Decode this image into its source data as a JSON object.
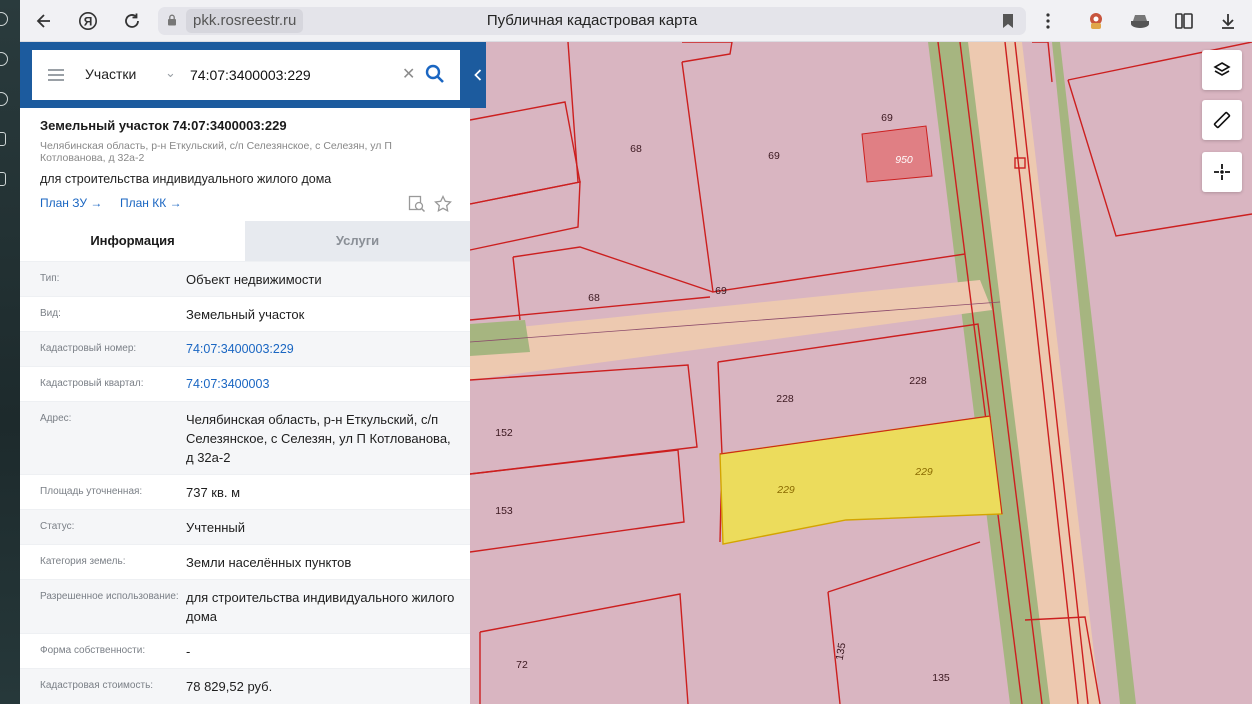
{
  "browser": {
    "host": "pkk.rosreestr.ru",
    "title": "Публичная кадастровая карта"
  },
  "search": {
    "layer": "Участки",
    "query": "74:07:3400003:229"
  },
  "card": {
    "title": "Земельный участок 74:07:3400003:229",
    "address": "Челябинская область, р-н Еткульский, с/п Селезянское, с Селезян, ул П Котлованова, д 32а-2",
    "purpose": "для строительства индивидуального жилого дома",
    "plan_zu": "План ЗУ →",
    "plan_kk": "План КК →"
  },
  "tabs": {
    "info": "Информация",
    "services": "Услуги"
  },
  "attributes": [
    {
      "key": "Тип:",
      "value": "Объект недвижимости"
    },
    {
      "key": "Вид:",
      "value": "Земельный участок"
    },
    {
      "key": "Кадастровый номер:",
      "value": "74:07:3400003:229"
    },
    {
      "key": "Кадастровый квартал:",
      "value": "74:07:3400003"
    },
    {
      "key": "Адрес:",
      "value": "Челябинская область, р-н Еткульский, с/п Селезянское, с Селезян, ул П Котлованова, д 32а-2"
    },
    {
      "key": "Площадь уточненная:",
      "value": "737 кв. м"
    },
    {
      "key": "Статус:",
      "value": "Учтенный"
    },
    {
      "key": "Категория земель:",
      "value": "Земли населённых пунктов"
    },
    {
      "key": "Разрешенное использование:",
      "value": "для строительства индивидуального жилого дома"
    },
    {
      "key": "Форма собственности:",
      "value": "-"
    },
    {
      "key": "Кадастровая стоимость:",
      "value": "78 829,52 руб."
    }
  ],
  "map_labels": [
    "69",
    "68",
    "69",
    "950",
    "68",
    "69",
    "228",
    "228",
    "152",
    "229",
    "229",
    "153",
    "72",
    "135",
    "135"
  ],
  "colors": {
    "parcel_fill": "#d9b5c1",
    "parcel_border": "#cc1f1f",
    "selected_fill": "#ecdc5c",
    "road": "#ecc9b1",
    "green": "#9fb27d",
    "panel_header": "#1c5b9e",
    "link": "#1a66c2"
  },
  "icons": {
    "back": "arrow-left-icon",
    "yandex": "yandex-icon",
    "reload": "reload-icon",
    "bookmark": "bookmark-icon",
    "menu": "more-vertical-icon",
    "layers": "layers-icon",
    "ruler": "ruler-icon",
    "locate": "crosshair-icon"
  }
}
